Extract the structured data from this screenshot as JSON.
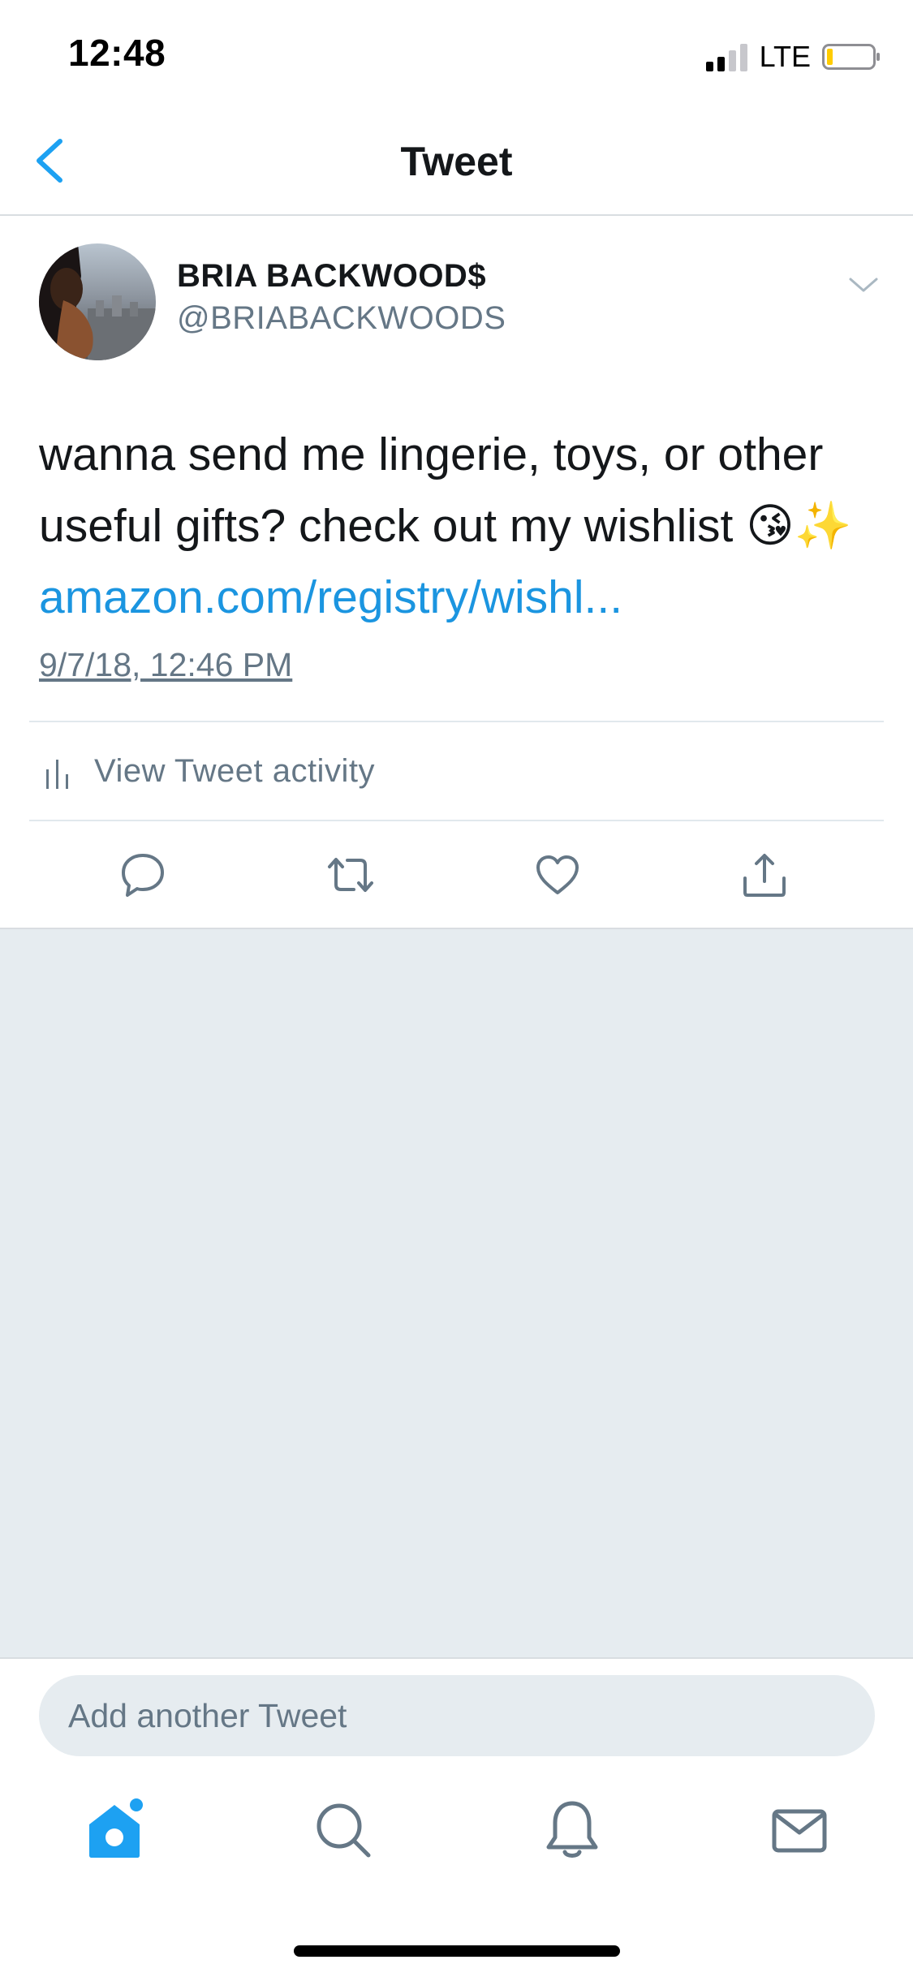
{
  "status_bar": {
    "time": "12:48",
    "network": "LTE"
  },
  "nav": {
    "title": "Tweet",
    "back_icon": "chevron-left-icon"
  },
  "tweet": {
    "display_name": "BRIA BACKWOOD$",
    "handle": "@BRIABACKWOODS",
    "text_line1": "wanna send me lingerie, toys, or other",
    "text_line2": "useful gifts? check out my wishlist",
    "emoji": "😘✨",
    "link": "amazon.com/registry/wishl...",
    "timestamp": "9/7/18, 12:46 PM",
    "activity_label": "View Tweet activity"
  },
  "actions": [
    {
      "name": "reply-icon"
    },
    {
      "name": "retweet-icon"
    },
    {
      "name": "like-icon"
    },
    {
      "name": "share-icon"
    }
  ],
  "compose": {
    "placeholder": "Add another Tweet"
  },
  "tabs": [
    {
      "name": "home-icon",
      "active": true
    },
    {
      "name": "search-icon",
      "active": false
    },
    {
      "name": "notifications-icon",
      "active": false
    },
    {
      "name": "messages-icon",
      "active": false
    }
  ],
  "colors": {
    "accent": "#1da1f2",
    "link": "#1b95e0",
    "secondary_text": "#657786",
    "primary_text": "#14171a",
    "background_gray": "#e6ecf0"
  }
}
